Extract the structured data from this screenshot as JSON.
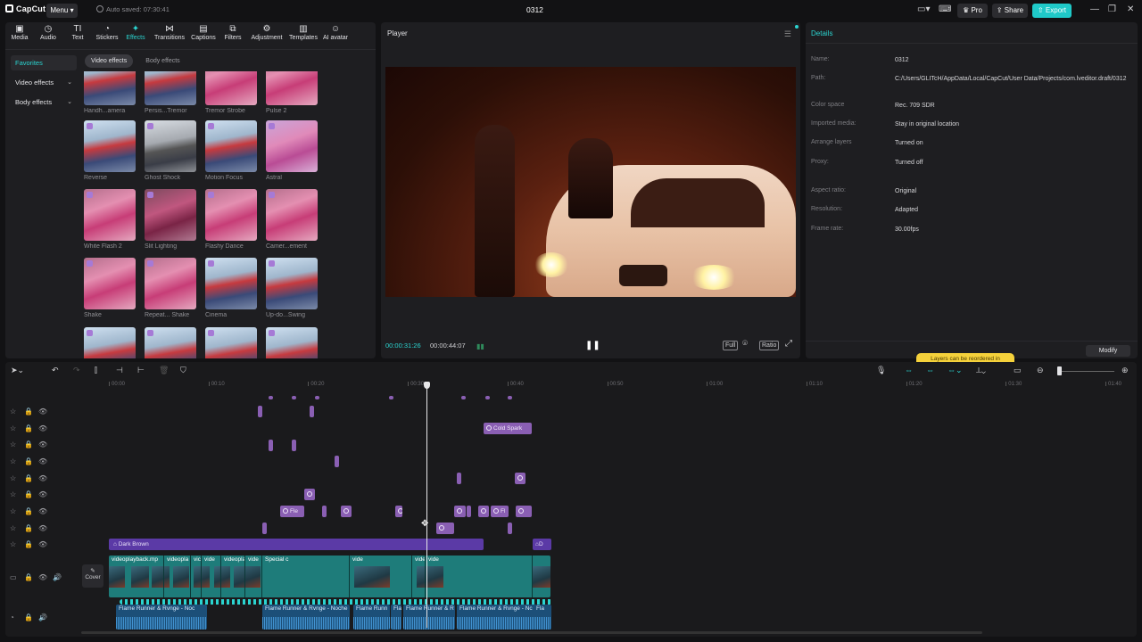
{
  "titlebar": {
    "logo": "CapCut",
    "menu": "Menu",
    "autosave": "Auto saved: 07:30:41",
    "project": "0312",
    "pro": "Pro",
    "share": "Share",
    "export": "Export"
  },
  "toolbar": {
    "tabs": [
      "Media",
      "Audio",
      "Text",
      "Stickers",
      "Effects",
      "Transitions",
      "Captions",
      "Filters",
      "Adjustment",
      "Templates",
      "AI avatar"
    ],
    "active": "Effects"
  },
  "sidenav": {
    "favorites": "Favorites",
    "video_effects": "Video effects",
    "body_effects": "Body effects"
  },
  "pills": {
    "video": "Video effects",
    "body": "Body effects"
  },
  "effects": [
    {
      "name": "Handh...amera",
      "style": "t-red"
    },
    {
      "name": "Persis...Tremor",
      "style": "t-red"
    },
    {
      "name": "Tremor Strobe",
      "style": "t-pink"
    },
    {
      "name": "Pulse 2",
      "style": "t-pink"
    },
    {
      "name": "Reverse",
      "style": "t-red"
    },
    {
      "name": "Ghost Shock",
      "style": "t-grey"
    },
    {
      "name": "Motion Focus",
      "style": "t-red"
    },
    {
      "name": "Astral",
      "style": "t-purple"
    },
    {
      "name": "White Flash 2",
      "style": "t-pink"
    },
    {
      "name": "Slit Lighting",
      "style": "t-dark"
    },
    {
      "name": "Flashy Dance",
      "style": "t-pink"
    },
    {
      "name": "Camer...ement",
      "style": "t-pink"
    },
    {
      "name": "Shake",
      "style": "t-pink"
    },
    {
      "name": "Repeat... Shake",
      "style": "t-pink"
    },
    {
      "name": "Cinema",
      "style": "t-red"
    },
    {
      "name": "Up-do...Swing",
      "style": "t-red"
    },
    {
      "name": "",
      "style": "t-red"
    },
    {
      "name": "",
      "style": "t-red"
    },
    {
      "name": "",
      "style": "t-red"
    },
    {
      "name": "",
      "style": "t-red"
    }
  ],
  "player": {
    "title": "Player",
    "current": "00:00:31:26",
    "total": "00:00:44:07",
    "full": "Full",
    "ratio": "Ratio"
  },
  "details": {
    "title": "Details",
    "rows": [
      {
        "label": "Name:",
        "value": "0312"
      },
      {
        "label": "Path:",
        "value": "C:/Users/GLITcH/AppData/Local/CapCut/User Data/Projects/com.lveditor.draft/0312"
      },
      {
        "label": "Color space",
        "value": "Rec. 709 SDR"
      },
      {
        "label": "Imported media:",
        "value": "Stay in original location"
      },
      {
        "label": "Arrange layers",
        "value": "Turned on"
      },
      {
        "label": "Proxy:",
        "value": "Turned off"
      },
      {
        "label": "Aspect ratio:",
        "value": "Original"
      },
      {
        "label": "Resolution:",
        "value": "Adapted"
      },
      {
        "label": "Frame rate:",
        "value": "30.00fps"
      }
    ],
    "tooltip": "Layers can be reordered in",
    "modify": "Modify"
  },
  "timeline": {
    "ruler": [
      "00:00",
      "00:10",
      "00:20",
      "00:30",
      "00:40",
      "00:50",
      "01:00",
      "01:10",
      "01:20",
      "01:30",
      "01:40"
    ],
    "fx_cold_spark": "Cold Spark",
    "fx_flo": "Fle",
    "fx_misc": "Fl",
    "filter": "Dark Brown",
    "filter2": "D",
    "cover": "Cover",
    "video_clips": [
      "videoplayback.mp",
      "videopla",
      "vic",
      "vide",
      "videopla",
      "vide",
      "Special c",
      "vide",
      "videopla",
      "vide"
    ],
    "audio_clips": [
      "Flame Runner & Rvnge - Noc",
      "Flame Runner & Rvnge - Noche",
      "Flame Runn",
      "Flar",
      "Flame Runner & R",
      "Flame Runner & Rvnge - Nc",
      "Fla"
    ]
  }
}
